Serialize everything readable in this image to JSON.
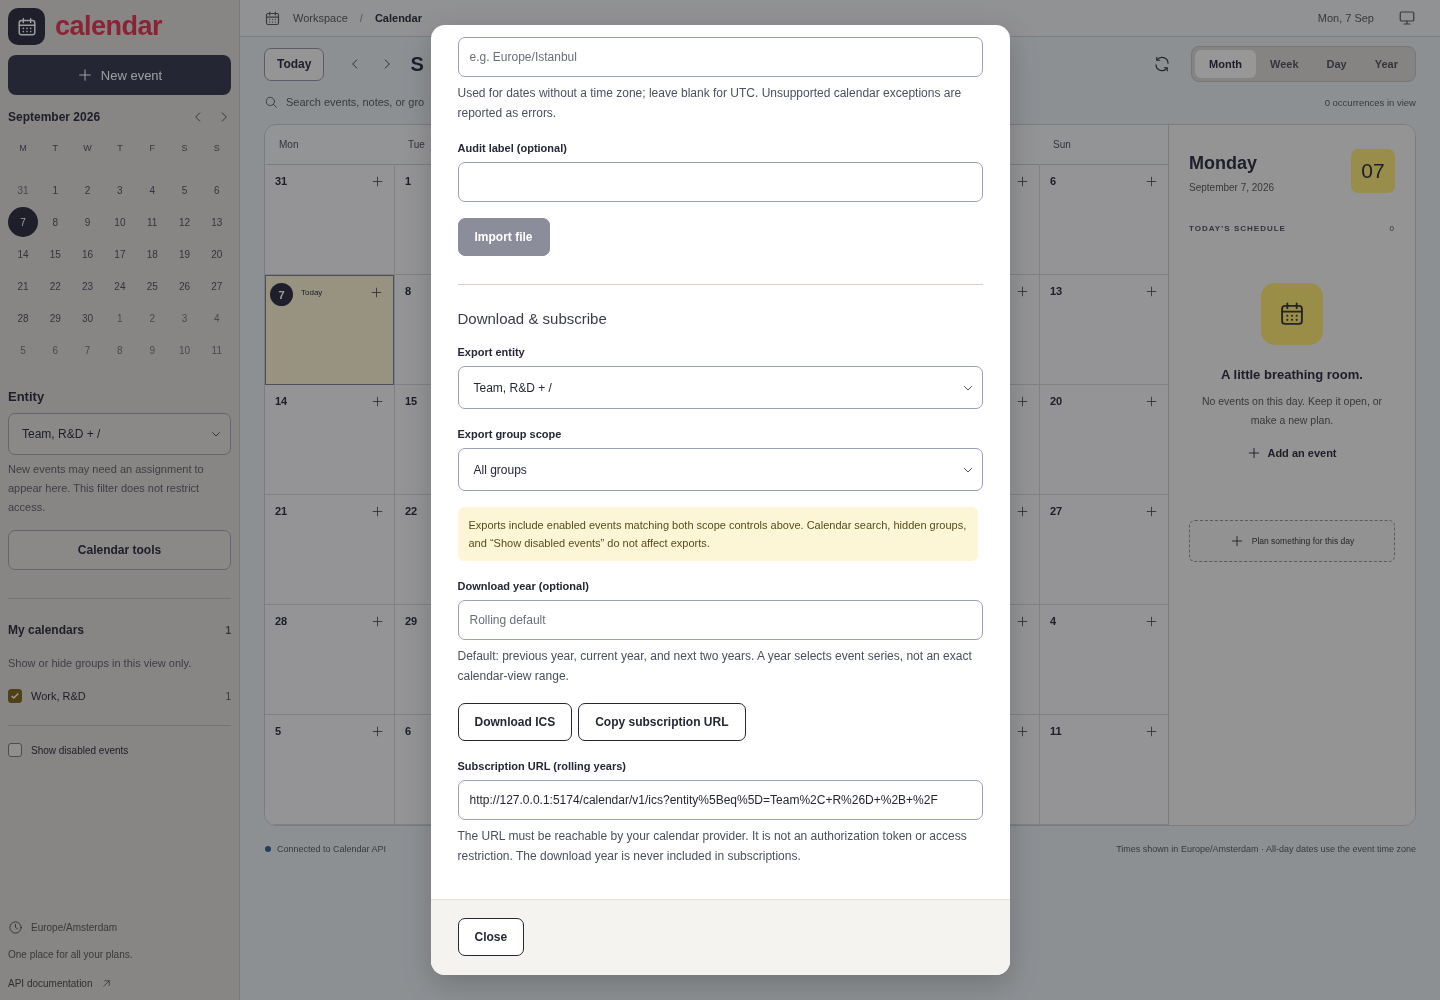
{
  "sidebar": {
    "logo_text": "calendar",
    "new_event": "New event",
    "mini_calendar": {
      "title": "September 2026",
      "weekdays": [
        "M",
        "T",
        "W",
        "T",
        "F",
        "S",
        "S"
      ],
      "weeks": [
        [
          {
            "label": "31",
            "outside": true,
            "selected": false
          },
          {
            "label": "1",
            "outside": false,
            "selected": false
          },
          {
            "label": "2",
            "outside": false,
            "selected": false
          },
          {
            "label": "3",
            "outside": false,
            "selected": false
          },
          {
            "label": "4",
            "outside": false,
            "selected": false
          },
          {
            "label": "5",
            "outside": false,
            "selected": false
          },
          {
            "label": "6",
            "outside": false,
            "selected": false
          }
        ],
        [
          {
            "label": "7",
            "outside": false,
            "selected": true
          },
          {
            "label": "8",
            "outside": false,
            "selected": false
          },
          {
            "label": "9",
            "outside": false,
            "selected": false
          },
          {
            "label": "10",
            "outside": false,
            "selected": false
          },
          {
            "label": "11",
            "outside": false,
            "selected": false
          },
          {
            "label": "12",
            "outside": false,
            "selected": false
          },
          {
            "label": "13",
            "outside": false,
            "selected": false
          }
        ],
        [
          {
            "label": "14",
            "outside": false,
            "selected": false
          },
          {
            "label": "15",
            "outside": false,
            "selected": false
          },
          {
            "label": "16",
            "outside": false,
            "selected": false
          },
          {
            "label": "17",
            "outside": false,
            "selected": false
          },
          {
            "label": "18",
            "outside": false,
            "selected": false
          },
          {
            "label": "19",
            "outside": false,
            "selected": false
          },
          {
            "label": "20",
            "outside": false,
            "selected": false
          }
        ],
        [
          {
            "label": "21",
            "outside": false,
            "selected": false
          },
          {
            "label": "22",
            "outside": false,
            "selected": false
          },
          {
            "label": "23",
            "outside": false,
            "selected": false
          },
          {
            "label": "24",
            "outside": false,
            "selected": false
          },
          {
            "label": "25",
            "outside": false,
            "selected": false
          },
          {
            "label": "26",
            "outside": false,
            "selected": false
          },
          {
            "label": "27",
            "outside": false,
            "selected": false
          }
        ],
        [
          {
            "label": "28",
            "outside": false,
            "selected": false
          },
          {
            "label": "29",
            "outside": false,
            "selected": false
          },
          {
            "label": "30",
            "outside": false,
            "selected": false
          },
          {
            "label": "1",
            "outside": true,
            "selected": false
          },
          {
            "label": "2",
            "outside": true,
            "selected": false
          },
          {
            "label": "3",
            "outside": true,
            "selected": false
          },
          {
            "label": "4",
            "outside": true,
            "selected": false
          }
        ],
        [
          {
            "label": "5",
            "outside": true,
            "selected": false
          },
          {
            "label": "6",
            "outside": true,
            "selected": false
          },
          {
            "label": "7",
            "outside": true,
            "selected": false
          },
          {
            "label": "8",
            "outside": true,
            "selected": false
          },
          {
            "label": "9",
            "outside": true,
            "selected": false
          },
          {
            "label": "10",
            "outside": true,
            "selected": false
          },
          {
            "label": "11",
            "outside": true,
            "selected": false
          }
        ]
      ]
    },
    "entity": {
      "label": "Entity",
      "value": "Team, R&D + /",
      "help": "New events may need an assignment to appear here. This filter does not restrict access."
    },
    "tools_button": "Calendar tools",
    "my_calendars": {
      "title": "My calendars",
      "count": "1",
      "help": "Show or hide groups in this view only.",
      "items": [
        {
          "label": "Work, R&D",
          "count": "1",
          "checked": true
        }
      ]
    },
    "show_disabled": {
      "label": "Show disabled events",
      "checked": false
    },
    "timezone": "Europe/Amsterdam",
    "tagline": "One place for all your plans.",
    "docs_link": "API documentation"
  },
  "topbar": {
    "breadcrumbs": [
      {
        "label": "Workspace",
        "current": false
      },
      {
        "label": "Calendar",
        "current": true
      }
    ],
    "separator": "/",
    "date": "Mon, 7 Sep"
  },
  "toolbar": {
    "today": "Today",
    "title": "S",
    "views": [
      {
        "label": "Month",
        "selected": true
      },
      {
        "label": "Week",
        "selected": false
      },
      {
        "label": "Day",
        "selected": false
      },
      {
        "label": "Year",
        "selected": false
      }
    ],
    "search_placeholder": "Search events, notes, or gro",
    "occurrences": "0 occurrences in view"
  },
  "month_grid": {
    "headers": {
      "mon": "Mon",
      "tue": "Tue",
      "sun": "Sun"
    },
    "weeks": [
      {
        "mon": {
          "day": "31",
          "today": false
        },
        "tue": "1",
        "sun": "6"
      },
      {
        "mon": {
          "day": "7",
          "today": true,
          "note": "Today"
        },
        "tue": "8",
        "sun": "13"
      },
      {
        "mon": {
          "day": "14",
          "today": false
        },
        "tue": "15",
        "sun": "20"
      },
      {
        "mon": {
          "day": "21",
          "today": false
        },
        "tue": "22",
        "sun": "27"
      },
      {
        "mon": {
          "day": "28",
          "today": false
        },
        "tue": "29",
        "sun": "4"
      },
      {
        "mon": {
          "day": "5",
          "today": false
        },
        "tue": "6",
        "sun": "11"
      }
    ]
  },
  "day_panel": {
    "weekday": "Monday",
    "date": "September 7, 2026",
    "day_badge": "07",
    "schedule_title": "TODAY’S SCHEDULE",
    "schedule_count": "0",
    "empty_title": "A little breathing room.",
    "empty_text": "No events on this day. Keep it open, or make a new plan.",
    "add_event": "Add an event",
    "plan": "Plan something for this day"
  },
  "footer": {
    "status": "Connected to Calendar API",
    "note": "Times shown in Europe/Amsterdam · All-day dates use the event time zone"
  },
  "modal": {
    "items": [
      {
        "kind": "input",
        "placeholder": "e.g. Europe/Istanbul"
      },
      {
        "kind": "help",
        "text": "Used for dates without a time zone; leave blank for UTC. Unsupported calendar exceptions are reported as errors."
      },
      {
        "kind": "label",
        "text": "Audit label (optional)"
      },
      {
        "kind": "input"
      },
      {
        "kind": "button",
        "label": "Import file",
        "disabled": true
      },
      {
        "kind": "divider"
      },
      {
        "kind": "heading",
        "text": "Download & subscribe"
      },
      {
        "kind": "label",
        "text": "Export entity"
      },
      {
        "kind": "select",
        "value": "Team, R&D + /"
      },
      {
        "kind": "label",
        "text": "Export group scope"
      },
      {
        "kind": "select",
        "value": "All groups"
      },
      {
        "kind": "note",
        "text": "Exports include enabled events matching both scope controls above. Calendar search, hidden groups, and “Show disabled events” do not affect exports."
      },
      {
        "kind": "label",
        "text": "Download year (optional)"
      },
      {
        "kind": "input",
        "placeholder": "Rolling default"
      },
      {
        "kind": "help",
        "text": "Default: previous year, current year, and next two years. A year selects event series, not an exact calendar-view range."
      },
      {
        "kind": "buttons",
        "buttons": [
          {
            "label": "Download ICS",
            "disabled": false
          },
          {
            "label": "Copy subscription URL",
            "disabled": false
          }
        ]
      },
      {
        "kind": "label",
        "text": "Subscription URL (rolling years)"
      },
      {
        "kind": "input",
        "value": "http://127.0.0.1:5174/calendar/v1/ics?entity%5Beq%5D=Team%2C+R%26D+%2B+%2F"
      },
      {
        "kind": "help",
        "text": "The URL must be reachable by your calendar provider. It is not an authorization token or access restriction. The download year is never included in subscriptions."
      }
    ],
    "close": "Close"
  }
}
